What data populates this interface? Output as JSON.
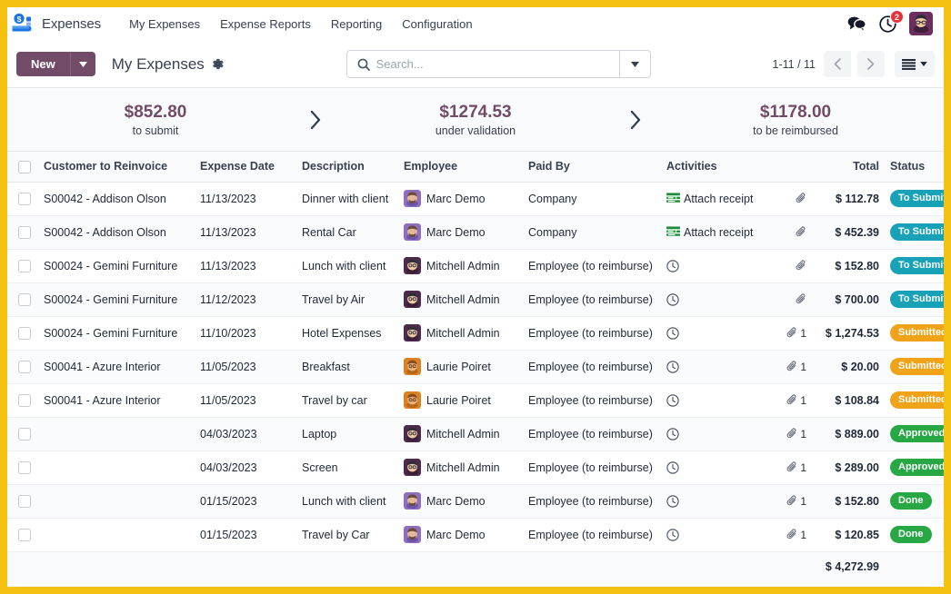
{
  "navbar": {
    "brand": "Expenses",
    "logo_icon": "expenses-money-icon",
    "menu": [
      {
        "label": "My Expenses"
      },
      {
        "label": "Expense Reports"
      },
      {
        "label": "Reporting"
      },
      {
        "label": "Configuration"
      }
    ],
    "messages_icon": "chat-bubbles-icon",
    "activities_icon": "clock-activities-icon",
    "activities_count": "2",
    "avatar_icon": "user-avatar"
  },
  "control_panel": {
    "new_label": "New",
    "new_caret_icon": "caret-down-icon",
    "breadcrumb": "My Expenses",
    "gear_icon": "gear-icon",
    "search": {
      "icon": "search-icon",
      "value": "",
      "placeholder": "Search...",
      "caret_icon": "caret-down-icon"
    },
    "pager": "1-11 / 11",
    "prev_icon": "chevron-left-icon",
    "next_icon": "chevron-right-icon",
    "view_switch_icon": "list-view-icon",
    "view_switch_caret_icon": "caret-down-icon"
  },
  "kpis": [
    {
      "amount": "$852.80",
      "label": "to submit"
    },
    {
      "amount": "$1274.53",
      "label": "under validation"
    },
    {
      "amount": "$1178.00",
      "label": "to be reimbursed"
    }
  ],
  "kpi_separator_icon": "chevron-right-icon",
  "table": {
    "select_all_icon": "checkbox",
    "optional_columns_icon": "sliders-icon",
    "columns": [
      "Customer to Reinvoice",
      "Expense Date",
      "Description",
      "Employee",
      "Paid By",
      "Activities",
      "Total",
      "Status"
    ],
    "rows": [
      {
        "customer": "S00042 - Addison Olson",
        "date": "11/13/2023",
        "description": "Dinner with client",
        "employee": "Marc Demo",
        "avatar": "#8E6FBF",
        "paid_by": "Company",
        "activity_icon": "receipt-icon",
        "activity": "Attach receipt",
        "attachment_icon": "paperclip-icon",
        "attachments": "",
        "total": "$ 112.78",
        "status": "To Submit",
        "status_class": "tosubmit"
      },
      {
        "customer": "S00042 - Addison Olson",
        "date": "11/13/2023",
        "description": "Rental Car",
        "employee": "Marc Demo",
        "avatar": "#8E6FBF",
        "paid_by": "Company",
        "activity_icon": "receipt-icon",
        "activity": "Attach receipt",
        "attachment_icon": "paperclip-icon",
        "attachments": "",
        "total": "$ 452.39",
        "status": "To Submit",
        "status_class": "tosubmit"
      },
      {
        "customer": "S00024 - Gemini Furniture",
        "date": "11/13/2023",
        "description": "Lunch with client",
        "employee": "Mitchell Admin",
        "avatar": "#4C2A4B",
        "paid_by": "Employee (to reimburse)",
        "activity_icon": "clock-icon",
        "activity": "",
        "attachment_icon": "paperclip-icon",
        "attachments": "",
        "total": "$ 152.80",
        "status": "To Submit",
        "status_class": "tosubmit"
      },
      {
        "customer": "S00024 - Gemini Furniture",
        "date": "11/12/2023",
        "description": "Travel by Air",
        "employee": "Mitchell Admin",
        "avatar": "#4C2A4B",
        "paid_by": "Employee (to reimburse)",
        "activity_icon": "clock-icon",
        "activity": "",
        "attachment_icon": "paperclip-icon",
        "attachments": "",
        "total": "$ 700.00",
        "status": "To Submit",
        "status_class": "tosubmit"
      },
      {
        "customer": "S00024 - Gemini Furniture",
        "date": "11/10/2023",
        "description": "Hotel Expenses",
        "employee": "Mitchell Admin",
        "avatar": "#4C2A4B",
        "paid_by": "Employee (to reimburse)",
        "activity_icon": "clock-icon",
        "activity": "",
        "attachment_icon": "paperclip-icon",
        "attachments": "1",
        "total": "$ 1,274.53",
        "status": "Submitted",
        "status_class": "submitted"
      },
      {
        "customer": "S00041 - Azure Interior",
        "date": "11/05/2023",
        "description": "Breakfast",
        "employee": "Laurie Poiret",
        "avatar": "#D98324",
        "paid_by": "Employee (to reimburse)",
        "activity_icon": "clock-icon",
        "activity": "",
        "attachment_icon": "paperclip-icon",
        "attachments": "1",
        "total": "$ 20.00",
        "status": "Submitted",
        "status_class": "submitted"
      },
      {
        "customer": "S00041 - Azure Interior",
        "date": "11/05/2023",
        "description": "Travel by car",
        "employee": "Laurie Poiret",
        "avatar": "#D98324",
        "paid_by": "Employee (to reimburse)",
        "activity_icon": "clock-icon",
        "activity": "",
        "attachment_icon": "paperclip-icon",
        "attachments": "1",
        "total": "$ 108.84",
        "status": "Submitted",
        "status_class": "submitted"
      },
      {
        "customer": "",
        "date": "04/03/2023",
        "description": "Laptop",
        "employee": "Mitchell Admin",
        "avatar": "#4C2A4B",
        "paid_by": "Employee (to reimburse)",
        "activity_icon": "clock-icon",
        "activity": "",
        "attachment_icon": "paperclip-icon",
        "attachments": "1",
        "total": "$ 889.00",
        "status": "Approved",
        "status_class": "approved"
      },
      {
        "customer": "",
        "date": "04/03/2023",
        "description": "Screen",
        "employee": "Mitchell Admin",
        "avatar": "#4C2A4B",
        "paid_by": "Employee (to reimburse)",
        "activity_icon": "clock-icon",
        "activity": "",
        "attachment_icon": "paperclip-icon",
        "attachments": "1",
        "total": "$ 289.00",
        "status": "Approved",
        "status_class": "approved"
      },
      {
        "customer": "",
        "date": "01/15/2023",
        "description": "Lunch with client",
        "employee": "Marc Demo",
        "avatar": "#8E6FBF",
        "paid_by": "Employee (to reimburse)",
        "activity_icon": "clock-icon",
        "activity": "",
        "attachment_icon": "paperclip-icon",
        "attachments": "1",
        "total": "$ 152.80",
        "status": "Done",
        "status_class": "done"
      },
      {
        "customer": "",
        "date": "01/15/2023",
        "description": "Travel by Car",
        "employee": "Marc Demo",
        "avatar": "#8E6FBF",
        "paid_by": "Employee (to reimburse)",
        "activity_icon": "clock-icon",
        "activity": "",
        "attachment_icon": "paperclip-icon",
        "attachments": "1",
        "total": "$ 120.85",
        "status": "Done",
        "status_class": "done"
      }
    ],
    "footer_total": "$ 4,272.99"
  },
  "colors": {
    "brand_purple": "#714B67",
    "accent_yellow": "#F5C211",
    "to_submit": "#17A2B8",
    "submitted": "#F0A318",
    "approved": "#28A745",
    "done": "#28A745",
    "badge_red": "#E5313A"
  }
}
